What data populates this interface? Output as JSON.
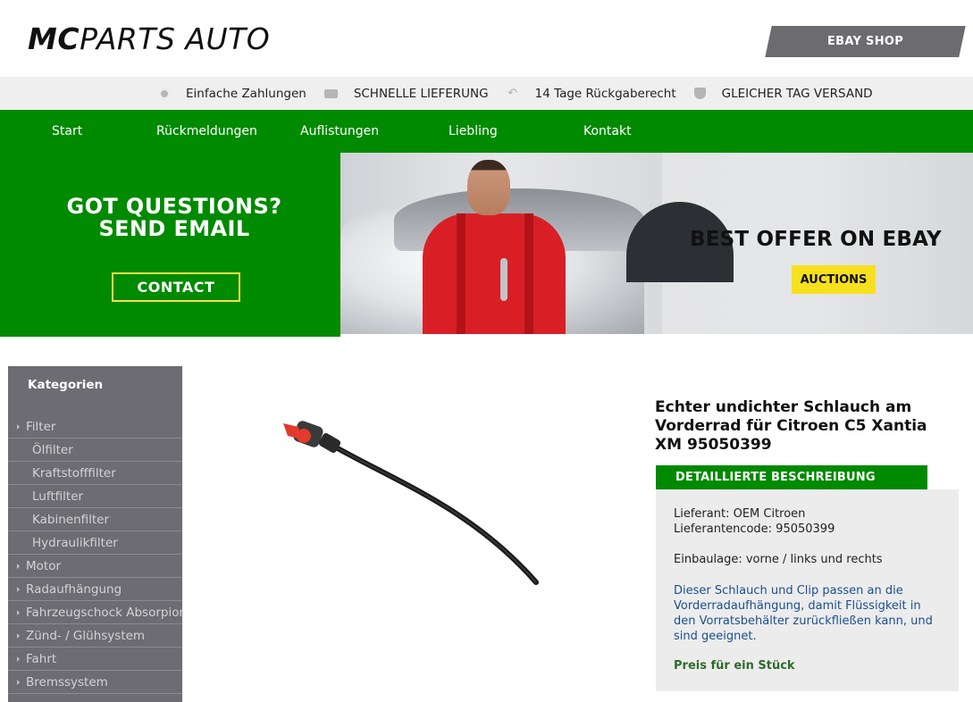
{
  "header": {
    "logo_bold": "MC",
    "logo_light": "PARTS AUTO",
    "ebay_shop_label": "EBAY SHOP"
  },
  "infobar": {
    "items": [
      {
        "icon": "gear-icon",
        "label": "Einfache Zahlungen"
      },
      {
        "icon": "truck-icon",
        "label": "SCHNELLE LIEFERUNG"
      },
      {
        "icon": "return-arrow-icon",
        "label": "14 Tage Rückgaberecht"
      },
      {
        "icon": "shield-check-icon",
        "label": "GLEICHER TAG VERSAND"
      }
    ]
  },
  "nav": {
    "items": [
      "Start",
      "Rückmeldungen",
      "Auflistungen",
      "Liebling",
      "Kontakt"
    ]
  },
  "promo": {
    "title_line1": "GOT QUESTIONS?",
    "title_line2": "SEND EMAIL",
    "contact_label": "CONTACT"
  },
  "hero": {
    "title": "BEST OFFER ON EBAY",
    "auctions_label": "AUCTIONS"
  },
  "sidebar": {
    "title": "Kategorien",
    "items": [
      {
        "label": "Filter",
        "sub": false
      },
      {
        "label": "Ölfilter",
        "sub": true
      },
      {
        "label": "Kraftstofffilter",
        "sub": true
      },
      {
        "label": "Luftfilter",
        "sub": true
      },
      {
        "label": "Kabinenfilter",
        "sub": true
      },
      {
        "label": "Hydraulikfilter",
        "sub": true
      },
      {
        "label": "Motor",
        "sub": false
      },
      {
        "label": "Radaufhängung",
        "sub": false
      },
      {
        "label": "Fahrzeugschock Absorpion",
        "sub": false
      },
      {
        "label": "Zünd- / Glühsystem",
        "sub": false
      },
      {
        "label": "Fahrt",
        "sub": false
      },
      {
        "label": "Bremssystem",
        "sub": false
      }
    ]
  },
  "product": {
    "title": "Echter undichter Schlauch am Vorderrad für Citroen C5 Xantia XM 95050399",
    "description_tab": "DETAILLIERTE BESCHREIBUNG",
    "supplier": "Lieferant: OEM Citroen",
    "supplier_code": "Lieferantencode: 95050399",
    "install_position": "Einbaulage: vorne / links und rechts",
    "description": "Dieser Schlauch und Clip passen an die Vorderradaufhängung, damit Flüssigkeit in den Vorratsbehälter zurückfließen kann, und sind geeignet.",
    "price_note": "Preis für ein Stück"
  },
  "colors": {
    "brand_green": "#008a00",
    "ebay_button": "#6b6b70",
    "sidebar_bg": "#6c6c72",
    "accent_yellow": "#f7e01d"
  }
}
